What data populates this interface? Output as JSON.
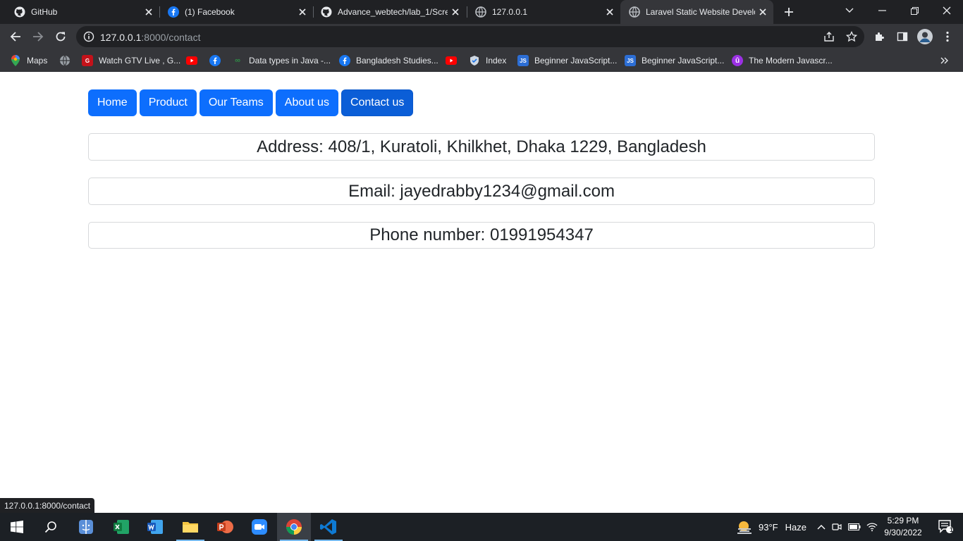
{
  "browser": {
    "tabs": [
      {
        "title": "GitHub",
        "icon": "github-icon"
      },
      {
        "title": "(1) Facebook",
        "icon": "facebook-icon"
      },
      {
        "title": "Advance_webtech/lab_1/Scre",
        "icon": "github-icon"
      },
      {
        "title": "127.0.0.1",
        "icon": "globe-icon"
      },
      {
        "title": "Laravel Static Website Develo",
        "icon": "globe-icon",
        "active": true
      }
    ],
    "url_host": "127.0.0.1",
    "url_path": ":8000/contact",
    "bookmarks": [
      {
        "label": "Maps",
        "icon": "maps-icon"
      },
      {
        "label": "",
        "icon": "globe-icon"
      },
      {
        "label": "Watch GTV Live , G...",
        "icon": "gtv-icon"
      },
      {
        "label": "",
        "icon": "youtube-icon"
      },
      {
        "label": "",
        "icon": "facebook-icon"
      },
      {
        "label": "Data types in Java -...",
        "icon": "gfg-icon"
      },
      {
        "label": "Bangladesh Studies...",
        "icon": "facebook-icon"
      },
      {
        "label": "",
        "icon": "youtube-icon"
      },
      {
        "label": "Index",
        "icon": "shield-icon"
      },
      {
        "label": "Beginner JavaScript...",
        "icon": "js-icon"
      },
      {
        "label": "Beginner JavaScript...",
        "icon": "js-icon"
      },
      {
        "label": "The Modern Javascr...",
        "icon": "tutorial-icon"
      }
    ],
    "status_url": "127.0.0.1:8000/contact"
  },
  "page": {
    "nav": [
      {
        "label": "Home"
      },
      {
        "label": "Product"
      },
      {
        "label": "Our Teams"
      },
      {
        "label": "About us"
      },
      {
        "label": "Contact us",
        "active": true
      }
    ],
    "address": "Address: 408/1, Kuratoli, Khilkhet, Dhaka 1229, Bangladesh",
    "email": "Email: jayedrabby1234@gmail.com",
    "phone": "Phone number: 01991954347"
  },
  "taskbar": {
    "weather_temp": "93°F",
    "weather_desc": "Haze",
    "time": "5:29 PM",
    "date": "9/30/2022",
    "notification_count": "1"
  },
  "colors": {
    "primary": "#0d6efd",
    "primary_active": "#0b5ed7",
    "chrome_dark": "#202124",
    "chrome_toolbar": "#35363a"
  }
}
